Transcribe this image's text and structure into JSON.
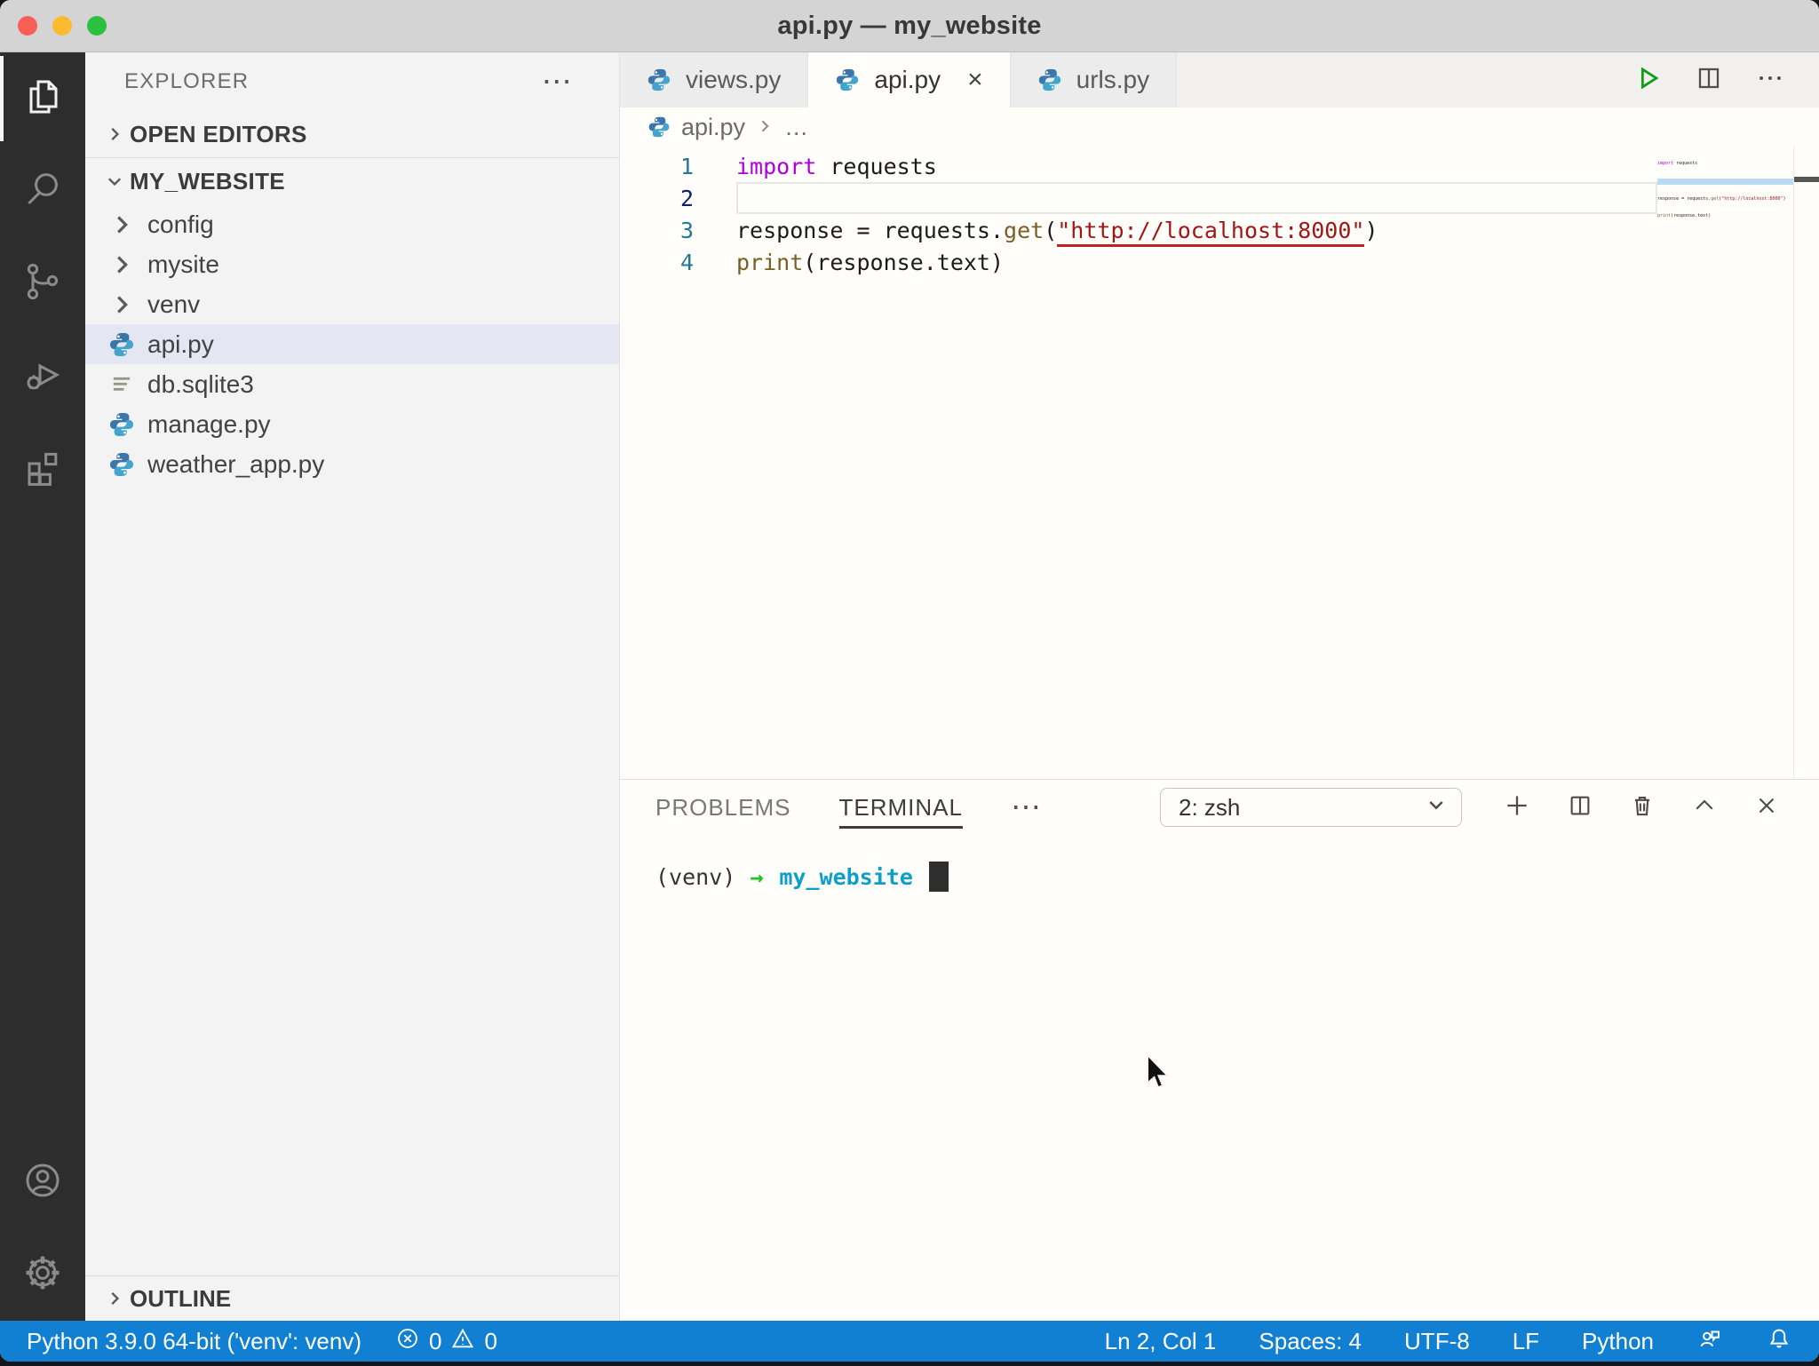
{
  "window": {
    "title": "api.py — my_website"
  },
  "activity_bar": {
    "items": [
      {
        "icon": "files-icon",
        "active": true
      },
      {
        "icon": "search-icon",
        "active": false
      },
      {
        "icon": "source-control-icon",
        "active": false
      },
      {
        "icon": "run-debug-icon",
        "active": false
      },
      {
        "icon": "extensions-icon",
        "active": false
      }
    ],
    "bottom_items": [
      {
        "icon": "account-icon"
      },
      {
        "icon": "settings-gear-icon"
      }
    ]
  },
  "sidebar": {
    "title": "EXPLORER",
    "more_label": "⋯",
    "open_editors_label": "OPEN EDITORS",
    "root_label": "MY_WEBSITE",
    "outline_label": "OUTLINE",
    "tree": [
      {
        "label": "config",
        "kind": "folder"
      },
      {
        "label": "mysite",
        "kind": "folder"
      },
      {
        "label": "venv",
        "kind": "folder"
      },
      {
        "label": "api.py",
        "kind": "python-file",
        "selected": true
      },
      {
        "label": "db.sqlite3",
        "kind": "file"
      },
      {
        "label": "manage.py",
        "kind": "python-file"
      },
      {
        "label": "weather_app.py",
        "kind": "python-file"
      }
    ]
  },
  "editor": {
    "tabs": [
      {
        "label": "views.py",
        "active": false
      },
      {
        "label": "api.py",
        "active": true,
        "close_label": "×"
      },
      {
        "label": "urls.py",
        "active": false
      }
    ],
    "breadcrumb": {
      "file": "api.py",
      "ellipsis": "…"
    },
    "code": {
      "line1": {
        "num": "1",
        "keyword": "import",
        "rest": " requests"
      },
      "line2": {
        "num": "2"
      },
      "line3": {
        "num": "3",
        "pre": "response = requests.",
        "func": "get",
        "open": "(",
        "string": "\"http://localhost:8000\"",
        "close": ")"
      },
      "line4": {
        "num": "4",
        "func": "print",
        "args": "(response.text)"
      }
    }
  },
  "panel": {
    "tabs": [
      {
        "label": "PROBLEMS",
        "active": false
      },
      {
        "label": "TERMINAL",
        "active": true
      }
    ],
    "more_label": "⋯",
    "shell_selector": {
      "value": "2: zsh"
    },
    "terminal": {
      "venv_prefix": "(venv)",
      "arrow": "→",
      "cwd": "my_website"
    }
  },
  "status_bar": {
    "interpreter": "Python 3.9.0 64-bit ('venv': venv)",
    "errors": "0",
    "warnings": "0",
    "cursor_position": "Ln 2, Col 1",
    "indentation": "Spaces: 4",
    "encoding": "UTF-8",
    "eol": "LF",
    "language": "Python"
  },
  "colors": {
    "status_bar_bg": "#1180d2",
    "activity_bar_bg": "#2d2d2d",
    "selected_row_bg": "#e4e6f1",
    "keyword": "#af00db",
    "string": "#a31515",
    "function": "#795e26",
    "terminal_arrow": "#1cc418",
    "terminal_cwd": "#0d9ec9",
    "traffic_red": "#f95f57",
    "traffic_yellow": "#fcbb2e",
    "traffic_green": "#2ac13f"
  }
}
